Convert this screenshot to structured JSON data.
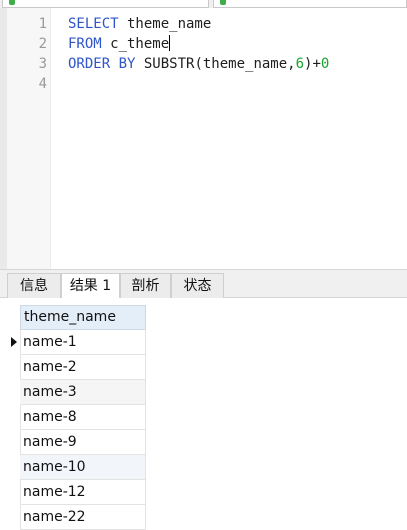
{
  "editor": {
    "line_numbers": [
      "1",
      "2",
      "3",
      "4"
    ],
    "lines": [
      {
        "kw": "SELECT",
        "rest": " theme_name"
      },
      {
        "kw": "FROM",
        "rest": " c_theme"
      },
      {
        "kw": "ORDER BY",
        "mid": " SUBSTR(theme_name,",
        "num1": "6",
        "close": ")+",
        "num2": "0"
      }
    ]
  },
  "tabs": [
    "信息",
    "结果 1",
    "剖析",
    "状态"
  ],
  "active_tab_index": 1,
  "result": {
    "column": "theme_name",
    "rows": [
      "name-1",
      "name-2",
      "name-3",
      "name-8",
      "name-9",
      "name-10",
      "name-12",
      "name-22"
    ],
    "selected_row_index": 0
  },
  "colors": {
    "keyword": "#2f55c8",
    "number": "#19a32c",
    "header_bg": "#e4eef9"
  }
}
